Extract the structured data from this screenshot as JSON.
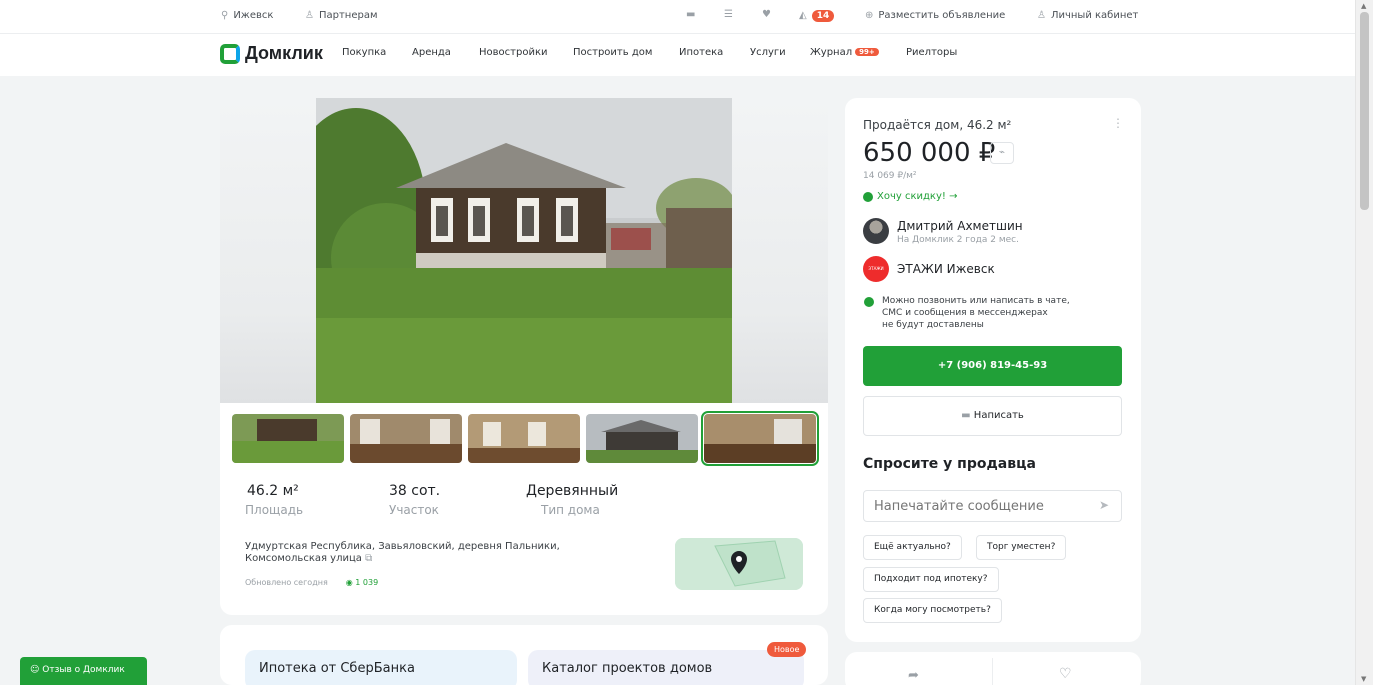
{
  "topbar": {
    "city": "Ижевск",
    "partners": "Партнерам",
    "notifications_count": "14",
    "post_ad": "Разместить объявление",
    "cabinet": "Личный кабинет"
  },
  "nav": {
    "logo": "Домклик",
    "items": [
      "Покупка",
      "Аренда",
      "Новостройки",
      "Построить дом",
      "Ипотека",
      "Услуги",
      "Журнал",
      "Риелторы"
    ],
    "journal_badge": "99+"
  },
  "listing": {
    "area_value": "46.2 м²",
    "area_label": "Площадь",
    "plot_value": "38 сот.",
    "plot_label": "Участок",
    "type_value": "Деревянный",
    "type_label": "Тип дома",
    "address_line1": "Удмуртская Республика, Завьяловский, деревня Пальники,",
    "address_line2": "Комсомольская улица",
    "updated": "Обновлено сегодня",
    "views": "1 039"
  },
  "promos": {
    "mortgage": "Ипотека от СберБанка",
    "catalog": "Каталог проектов домов",
    "new_badge": "Новое"
  },
  "sidebar": {
    "title": "Продаётся дом, 46.2 м²",
    "price": "650 000 ₽",
    "per_m2": "14 069 ₽/м²",
    "discount": "Хочу скидку! →",
    "agent_name": "Дмитрий Ахметшин",
    "agent_since": "На Домклик 2 года 2 мес.",
    "agency": "ЭТАЖИ Ижевск",
    "agency_logo_text": "ЭТАЖИ",
    "note_line1": "Можно позвонить или написать в чате,",
    "note_line2": "СМС и сообщения в мессенджерах",
    "note_line3": "не будут доставлены",
    "phone": "+7 (906) 819-45-93",
    "write": "Написать",
    "ask_title": "Спросите у продавца",
    "message_placeholder": "Напечатайте сообщение",
    "chips": [
      "Ещё актуально?",
      "Торг уместен?",
      "Подходит под ипотеку?",
      "Когда могу посмотреть?"
    ]
  },
  "feedback": "Отзыв о Домклик",
  "colors": {
    "accent": "#21a038",
    "badge": "#ef5a3c",
    "background": "#f2f4f5"
  }
}
